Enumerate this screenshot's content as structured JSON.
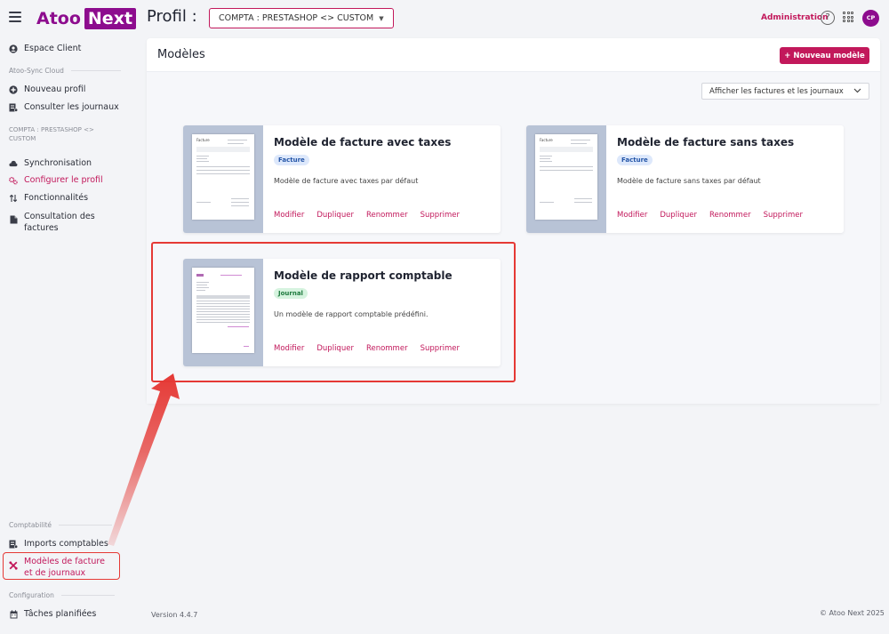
{
  "header": {
    "logo": {
      "atoo": "Atoo",
      "next": "Next"
    },
    "profil_label": "Profil :",
    "profil_select": "COMPTA : PRESTASHOP <> CUSTOM",
    "admin_link": "Administration",
    "help_glyph": "?",
    "avatar_initials": "CP"
  },
  "sidebar": {
    "espace_client": "Espace Client",
    "section_cloud": "Atoo-Sync Cloud",
    "nouveau_profil": "Nouveau profil",
    "consulter_journaux": "Consulter les journaux",
    "profile_label": "COMPTA : PRESTASHOP <> CUSTOM",
    "synchronisation": "Synchronisation",
    "configurer_profil": "Configurer le profil",
    "fonctionnalites": "Fonctionnalités",
    "consultation_factures": "Consultation des factures",
    "section_comptabilite": "Comptabilité",
    "imports_comptables": "Imports comptables",
    "modeles_facture": "Modèles de facture et de journaux",
    "section_configuration": "Configuration",
    "taches_planifiees": "Tâches planifiées"
  },
  "main": {
    "title": "Modèles",
    "new_button": "Nouveau modèle",
    "new_button_icon": "+",
    "filter_value": "Afficher les factures et les journaux",
    "actions": {
      "modifier": "Modifier",
      "dupliquer": "Dupliquer",
      "renommer": "Renommer",
      "supprimer": "Supprimer"
    },
    "templates": [
      {
        "title": "Modèle de facture avec taxes",
        "badge": "Facture",
        "description": "Modèle de facture avec taxes par défaut",
        "doc_title": "Facture"
      },
      {
        "title": "Modèle de facture sans taxes",
        "badge": "Facture",
        "description": "Modèle de facture sans taxes par défaut",
        "doc_title": "Facture"
      },
      {
        "title": "Modèle de rapport comptable",
        "badge": "Journal",
        "description": "Un modèle de rapport comptable prédéfini."
      }
    ]
  },
  "footer": {
    "version": "Version 4.4.7",
    "copyright": "© Atoo Next 2025"
  },
  "colors": {
    "brand": "#8d0c8e",
    "accent": "#c2185b",
    "annotation": "#e53935"
  },
  "icons": {
    "menu": "hamburger-icon",
    "help": "help-circle-icon",
    "apps": "apps-grid-icon",
    "dropdown": "chevron-down-icon"
  }
}
